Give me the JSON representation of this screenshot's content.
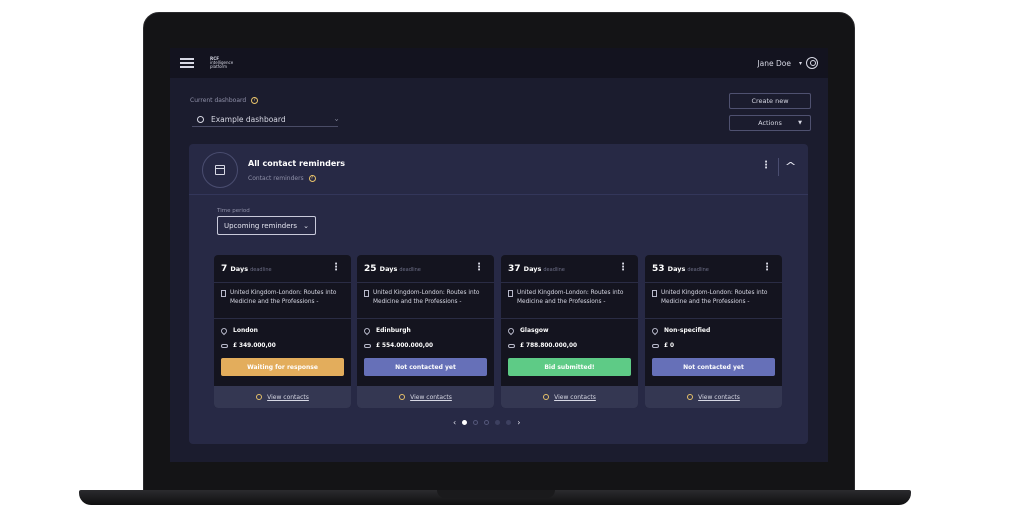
{
  "topbar": {
    "logo_main": "RCF",
    "logo_line1": "intelligence",
    "logo_line2": "platform",
    "user_name": "Jane Doe"
  },
  "dashboard": {
    "current_label": "Current dashboard",
    "selected": "Example dashboard",
    "create_label": "Create new",
    "actions_label": "Actions"
  },
  "panel": {
    "title": "All contact reminders",
    "subtitle": "Contact reminders",
    "time_period_label": "Time period",
    "time_period_value": "Upcoming reminders"
  },
  "cards": [
    {
      "days": "7",
      "unit": "Days",
      "deadline": "deadline",
      "route": "United Kingdom-London: Routes into Medicine and the Professions -",
      "location": "London",
      "value": "£ 349.000,00",
      "status": "Waiting for response",
      "status_color": "#e3ad5c",
      "view": "View contacts"
    },
    {
      "days": "25",
      "unit": "Days",
      "deadline": "deadline",
      "route": "United Kingdom-London: Routes into Medicine and the Professions -",
      "location": "Edinburgh",
      "value": "£ 554.000.000,00",
      "status": "Not contacted yet",
      "status_color": "#6670b8",
      "view": "View contacts"
    },
    {
      "days": "37",
      "unit": "Days",
      "deadline": "deadline",
      "route": "United Kingdom-London: Routes into Medicine and the Professions -",
      "location": "Glasgow",
      "value": "£ 788.800.000,00",
      "status": "Bid submitted!",
      "status_color": "#5ecb86",
      "view": "View contacts"
    },
    {
      "days": "53",
      "unit": "Days",
      "deadline": "deadline",
      "route": "United Kingdom-London: Routes into Medicine and the Professions -",
      "location": "Non-specified",
      "value": "£ 0",
      "status": "Not contacted yet",
      "status_color": "#6670b8",
      "view": "View contacts"
    }
  ],
  "pager": {
    "prev": "‹",
    "next": "›",
    "current_page": 1,
    "page_count": 5
  },
  "icons": {
    "menu": "hamburger-menu-icon",
    "user": "user-circle-icon",
    "help": "question-circle-icon",
    "dashboard": "dashboard-icon",
    "calendar": "calendar-icon",
    "building": "building-icon",
    "pin": "location-pin-icon",
    "money": "money-icon",
    "contacts": "contacts-icon"
  }
}
